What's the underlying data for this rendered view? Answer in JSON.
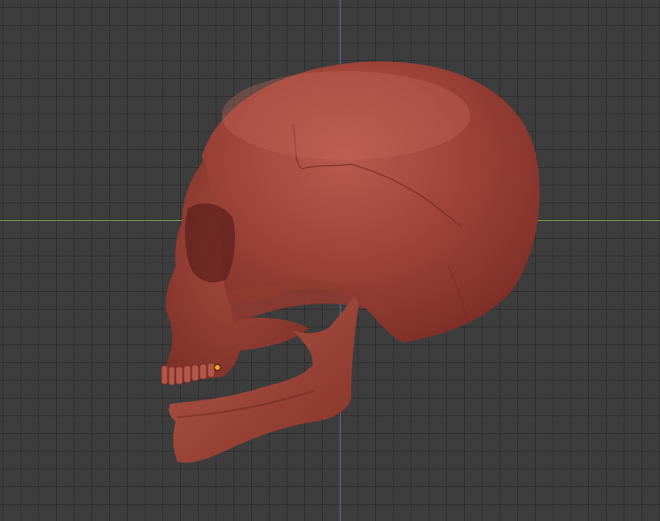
{
  "viewport": {
    "background_color": "#3d3d3d",
    "grid_color": "#2e2e2e",
    "x_axis_color": "#7ca33b",
    "y_axis_color": "#4f7fb8"
  },
  "object": {
    "mesh_icon": "skull-mesh",
    "material_color": "#a5463c",
    "origin_color": "#ff9d1a"
  }
}
